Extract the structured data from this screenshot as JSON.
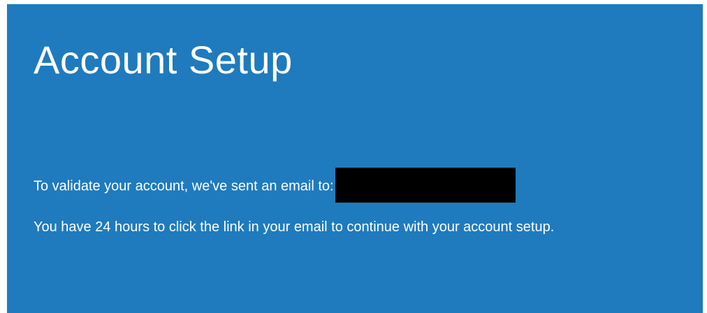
{
  "panel": {
    "background": "#1f7bbd",
    "title": "Account Setup",
    "validation_message": "To validate your account, we've sent an email to:",
    "expiry_message": "You have 24 hours to click the link in your email to continue with your account setup."
  }
}
